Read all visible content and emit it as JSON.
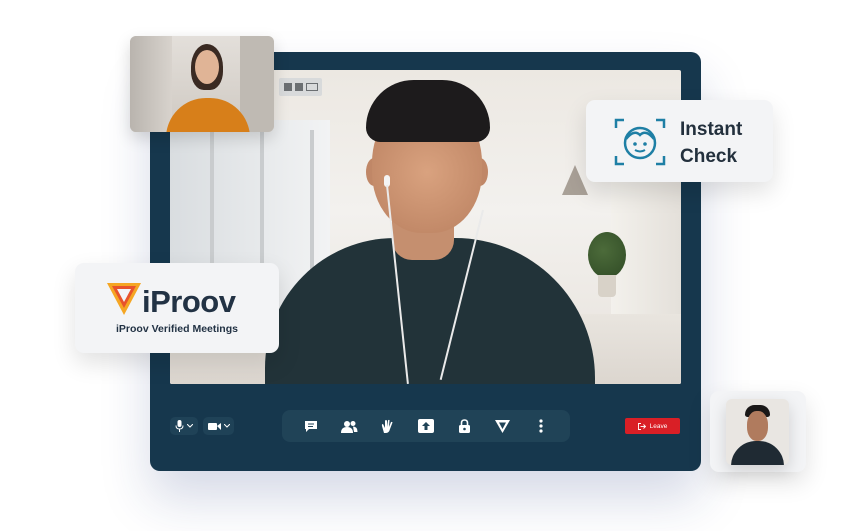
{
  "brand": {
    "name": "iProov",
    "subtitle": "iProov Verified Meetings",
    "accent_colors": [
      "#f5a623",
      "#e8532b"
    ]
  },
  "instant_check": {
    "label_line1": "Instant",
    "label_line2": "Check",
    "icon": "face-scan-icon",
    "icon_color": "#1e7fa5"
  },
  "controls": {
    "mic_icon": "microphone-icon",
    "camera_icon": "camera-icon",
    "toolbar_icons": [
      "chat-icon",
      "participants-icon",
      "reactions-icon",
      "share-screen-icon",
      "lock-icon",
      "iproov-shield-icon",
      "more-options-icon"
    ],
    "leave_label": "Leave",
    "leave_color": "#d91f26"
  },
  "colors": {
    "window_bg": "#16374d",
    "toolbar_bg": "#204357"
  }
}
